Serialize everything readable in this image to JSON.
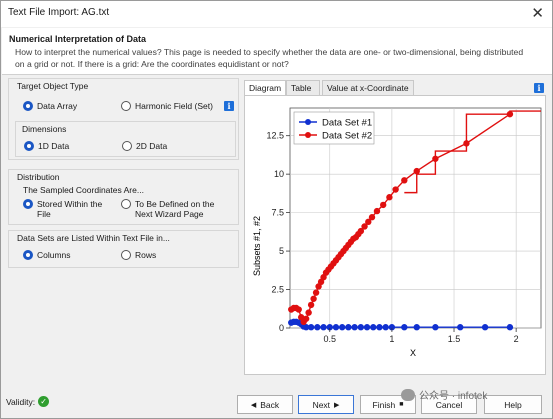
{
  "window": {
    "title": "Text File Import: AG.txt",
    "close_glyph": "✕"
  },
  "header": {
    "title": "Numerical Interpretation of Data",
    "description": "How to interpret the numerical values? This page is needed to specify whether the data are one- or two-dimensional, being distributed on a grid or not. If there is a grid: Are the coordinates equidistant or not?"
  },
  "target_object": {
    "title": "Target Object Type",
    "options": [
      "Data Array",
      "Harmonic Field (Set)"
    ],
    "selected": "Data Array",
    "info_icon": "info-icon",
    "dimensions": {
      "title": "Dimensions",
      "options": [
        "1D Data",
        "2D Data"
      ],
      "selected": "1D Data"
    }
  },
  "distribution": {
    "title": "Distribution",
    "subtitle": "The Sampled Coordinates Are...",
    "options": [
      "Stored Within the File",
      "To Be Defined on the Next Wizard Page"
    ],
    "selected": "Stored Within the File"
  },
  "listing": {
    "title": "Data Sets are Listed Within Text File in...",
    "options": [
      "Columns",
      "Rows"
    ],
    "selected": "Columns"
  },
  "tabs": [
    {
      "label": "Diagram",
      "active": true
    },
    {
      "label": "Table",
      "active": false
    },
    {
      "label": "Value at x-Coordinate",
      "active": false
    }
  ],
  "chart_data": {
    "type": "line",
    "xlabel": "X",
    "ylabel": "Subsets #1, #2",
    "xlim": [
      0.18,
      2.2
    ],
    "ylim": [
      0,
      14.3
    ],
    "xticks": [
      "0.5",
      "1",
      "1.5",
      "2"
    ],
    "yticks": [
      "0",
      "2.5",
      "5",
      "7.5",
      "10",
      "12.5"
    ],
    "legend_position": "top-left",
    "series": [
      {
        "name": "Data Set #1",
        "color": "#1030d0",
        "x": [
          0.19,
          0.21,
          0.23,
          0.25,
          0.27,
          0.29,
          0.31,
          0.35,
          0.4,
          0.45,
          0.5,
          0.55,
          0.6,
          0.65,
          0.7,
          0.75,
          0.8,
          0.85,
          0.9,
          0.95,
          1.0,
          1.1,
          1.2,
          1.35,
          1.55,
          1.75,
          1.95
        ],
        "y": [
          0.35,
          0.4,
          0.4,
          0.35,
          0.25,
          0.1,
          0.05,
          0.05,
          0.05,
          0.05,
          0.05,
          0.05,
          0.05,
          0.05,
          0.05,
          0.05,
          0.05,
          0.05,
          0.05,
          0.05,
          0.05,
          0.05,
          0.05,
          0.05,
          0.05,
          0.05,
          0.05
        ],
        "step_x": [],
        "step_y": []
      },
      {
        "name": "Data Set #2",
        "color": "#e01010",
        "x": [
          0.19,
          0.21,
          0.23,
          0.25,
          0.27,
          0.29,
          0.31,
          0.33,
          0.35,
          0.37,
          0.39,
          0.41,
          0.43,
          0.45,
          0.47,
          0.49,
          0.51,
          0.53,
          0.55,
          0.57,
          0.59,
          0.61,
          0.63,
          0.65,
          0.67,
          0.69,
          0.71,
          0.73,
          0.75,
          0.78,
          0.81,
          0.84,
          0.88,
          0.93,
          0.98,
          1.03,
          1.1,
          1.2,
          1.35,
          1.6,
          1.95
        ],
        "y": [
          1.2,
          1.3,
          1.3,
          1.2,
          0.7,
          0.4,
          0.6,
          1.0,
          1.5,
          1.9,
          2.3,
          2.7,
          3.0,
          3.3,
          3.6,
          3.8,
          4.0,
          4.2,
          4.4,
          4.6,
          4.8,
          5.0,
          5.2,
          5.4,
          5.6,
          5.8,
          5.9,
          6.1,
          6.3,
          6.6,
          6.9,
          7.2,
          7.6,
          8.0,
          8.5,
          9.0,
          9.6,
          10.2,
          11.0,
          12.0,
          13.9
        ],
        "step_x": [
          1.1,
          1.2,
          1.2,
          1.35,
          1.35,
          1.6,
          1.6,
          1.95,
          1.95,
          2.2
        ],
        "step_y": [
          8.8,
          8.8,
          10.0,
          10.0,
          11.5,
          11.5,
          13.9,
          13.9,
          14.1,
          14.1
        ]
      }
    ]
  },
  "footer": {
    "validity_label": "Validity:",
    "buttons": [
      {
        "label": "Back",
        "glyph": "◀"
      },
      {
        "label": "Next",
        "glyph": "▶"
      },
      {
        "label": "Finish",
        "glyph": "■"
      },
      {
        "label": "Cancel",
        "glyph": ""
      },
      {
        "label": "Help",
        "glyph": ""
      }
    ]
  },
  "watermark": {
    "text": "公众号 · infotek"
  }
}
